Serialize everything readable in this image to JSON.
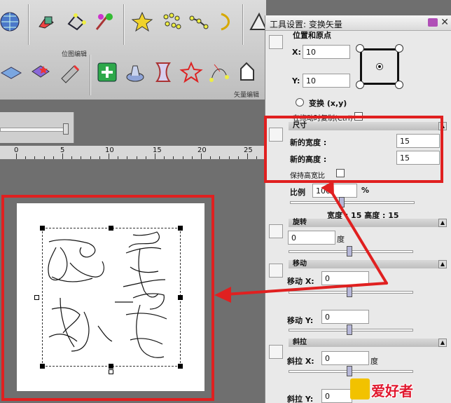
{
  "toolbar": {
    "group1_label": "位图编辑",
    "group2_label": "矢量编辑",
    "row1_tools": [
      "globe-tool",
      "shape-tool",
      "node-tool",
      "paint-tool",
      "star-tool",
      "dots-tool",
      "trace-tool",
      "curve-tool",
      "mirror-tool"
    ],
    "row2_tools": [
      "layer-tool",
      "star-burst-tool",
      "knife-tool",
      "add-tool",
      "lamp-tool",
      "warp-tool",
      "wave-star-tool",
      "bezier-tool",
      "outline-tool"
    ]
  },
  "ruler": {
    "labels": [
      "0",
      "5",
      "10",
      "15",
      "20",
      "25"
    ]
  },
  "panel": {
    "title": "工具设置: 变换矢量",
    "position_section": {
      "title": "位置和原点",
      "x_label": "X:",
      "x_value": "10",
      "y_label": "Y:",
      "y_value": "10",
      "transform_label": "变换 (x,y)",
      "copy_label": "在拖动时复制(Ctrl)"
    },
    "size_section": {
      "title": "尺寸",
      "width_label": "新的宽度 :",
      "width_value": "15",
      "height_label": "新的高度 :",
      "height_value": "15",
      "keep_ratio_label": "保持高宽比"
    },
    "scale": {
      "label": "比例",
      "value": "100",
      "unit": "%",
      "summary": "宽度 : 15  高度 : 15"
    },
    "rotate_section": {
      "title": "旋转",
      "value": "0",
      "unit": "度"
    },
    "move_section": {
      "title": "移动",
      "x_label": "移动 X:",
      "x_value": "0",
      "y_label": "移动 Y:",
      "y_value": "0"
    },
    "skew_section": {
      "title": "斜拉",
      "x_label": "斜拉 X:",
      "x_value": "0",
      "x_unit": "度",
      "y_label": "斜拉 Y:",
      "y_value": "0"
    }
  },
  "watermark": {
    "text": "爱好者"
  },
  "colors": {
    "highlight": "#e02020",
    "panel_bg": "#e9e9e9",
    "slider_thumb": "#b6b7d8"
  }
}
